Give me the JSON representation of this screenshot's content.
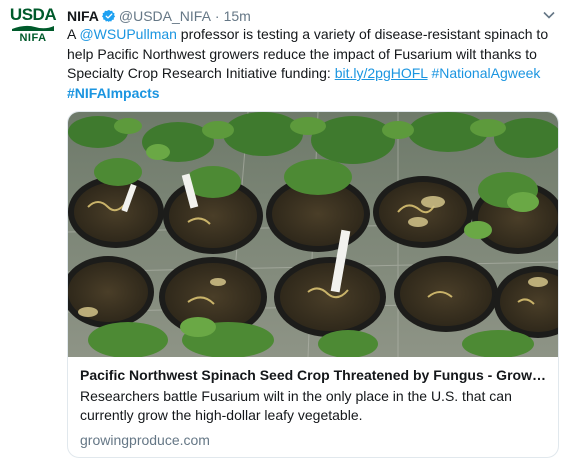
{
  "account": {
    "logo_top": "USDA",
    "logo_bottom": "NIFA",
    "name": "NIFA",
    "handle": "@USDA_NIFA",
    "separator": "·",
    "time": "15m"
  },
  "tweet": {
    "t1": "A ",
    "mention": "@WSUPullman",
    "t2": " professor is testing a variety of disease-resistant spinach to help Pacific Northwest growers reduce the impact of Fusarium wilt thanks to Specialty Crop Research Initiative funding: ",
    "link": "bit.ly/2pgHOFL",
    "t3": " ",
    "hashtag1": "#NationalAgweek",
    "hashtag2": "#NIFAImpacts"
  },
  "card": {
    "title": "Pacific Northwest Spinach Seed Crop Threatened by Fungus - Growi...",
    "description": "Researchers battle Fusarium wilt in the only place in the U.S. that can currently grow the high-dollar leafy vegetable.",
    "domain": "growingproduce.com"
  },
  "colors": {
    "link": "#1b95e0",
    "usda_green": "#005a2b",
    "muted": "#657786"
  },
  "icons": [
    "usda-logo",
    "verified-badge-icon",
    "chevron-down-icon"
  ]
}
